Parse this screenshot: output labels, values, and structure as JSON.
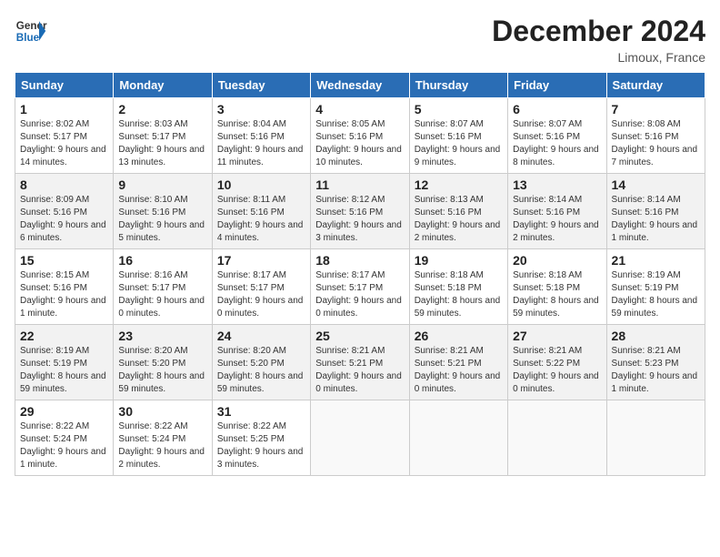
{
  "header": {
    "logo_general": "General",
    "logo_blue": "Blue",
    "month_title": "December 2024",
    "location": "Limoux, France"
  },
  "weekdays": [
    "Sunday",
    "Monday",
    "Tuesday",
    "Wednesday",
    "Thursday",
    "Friday",
    "Saturday"
  ],
  "weeks": [
    [
      {
        "day": "1",
        "sunrise": "8:02 AM",
        "sunset": "5:17 PM",
        "daylight": "9 hours and 14 minutes."
      },
      {
        "day": "2",
        "sunrise": "8:03 AM",
        "sunset": "5:17 PM",
        "daylight": "9 hours and 13 minutes."
      },
      {
        "day": "3",
        "sunrise": "8:04 AM",
        "sunset": "5:16 PM",
        "daylight": "9 hours and 11 minutes."
      },
      {
        "day": "4",
        "sunrise": "8:05 AM",
        "sunset": "5:16 PM",
        "daylight": "9 hours and 10 minutes."
      },
      {
        "day": "5",
        "sunrise": "8:07 AM",
        "sunset": "5:16 PM",
        "daylight": "9 hours and 9 minutes."
      },
      {
        "day": "6",
        "sunrise": "8:07 AM",
        "sunset": "5:16 PM",
        "daylight": "9 hours and 8 minutes."
      },
      {
        "day": "7",
        "sunrise": "8:08 AM",
        "sunset": "5:16 PM",
        "daylight": "9 hours and 7 minutes."
      }
    ],
    [
      {
        "day": "8",
        "sunrise": "8:09 AM",
        "sunset": "5:16 PM",
        "daylight": "9 hours and 6 minutes."
      },
      {
        "day": "9",
        "sunrise": "8:10 AM",
        "sunset": "5:16 PM",
        "daylight": "9 hours and 5 minutes."
      },
      {
        "day": "10",
        "sunrise": "8:11 AM",
        "sunset": "5:16 PM",
        "daylight": "9 hours and 4 minutes."
      },
      {
        "day": "11",
        "sunrise": "8:12 AM",
        "sunset": "5:16 PM",
        "daylight": "9 hours and 3 minutes."
      },
      {
        "day": "12",
        "sunrise": "8:13 AM",
        "sunset": "5:16 PM",
        "daylight": "9 hours and 2 minutes."
      },
      {
        "day": "13",
        "sunrise": "8:14 AM",
        "sunset": "5:16 PM",
        "daylight": "9 hours and 2 minutes."
      },
      {
        "day": "14",
        "sunrise": "8:14 AM",
        "sunset": "5:16 PM",
        "daylight": "9 hours and 1 minute."
      }
    ],
    [
      {
        "day": "15",
        "sunrise": "8:15 AM",
        "sunset": "5:16 PM",
        "daylight": "9 hours and 1 minute."
      },
      {
        "day": "16",
        "sunrise": "8:16 AM",
        "sunset": "5:17 PM",
        "daylight": "9 hours and 0 minutes."
      },
      {
        "day": "17",
        "sunrise": "8:17 AM",
        "sunset": "5:17 PM",
        "daylight": "9 hours and 0 minutes."
      },
      {
        "day": "18",
        "sunrise": "8:17 AM",
        "sunset": "5:17 PM",
        "daylight": "9 hours and 0 minutes."
      },
      {
        "day": "19",
        "sunrise": "8:18 AM",
        "sunset": "5:18 PM",
        "daylight": "8 hours and 59 minutes."
      },
      {
        "day": "20",
        "sunrise": "8:18 AM",
        "sunset": "5:18 PM",
        "daylight": "8 hours and 59 minutes."
      },
      {
        "day": "21",
        "sunrise": "8:19 AM",
        "sunset": "5:19 PM",
        "daylight": "8 hours and 59 minutes."
      }
    ],
    [
      {
        "day": "22",
        "sunrise": "8:19 AM",
        "sunset": "5:19 PM",
        "daylight": "8 hours and 59 minutes."
      },
      {
        "day": "23",
        "sunrise": "8:20 AM",
        "sunset": "5:20 PM",
        "daylight": "8 hours and 59 minutes."
      },
      {
        "day": "24",
        "sunrise": "8:20 AM",
        "sunset": "5:20 PM",
        "daylight": "8 hours and 59 minutes."
      },
      {
        "day": "25",
        "sunrise": "8:21 AM",
        "sunset": "5:21 PM",
        "daylight": "9 hours and 0 minutes."
      },
      {
        "day": "26",
        "sunrise": "8:21 AM",
        "sunset": "5:21 PM",
        "daylight": "9 hours and 0 minutes."
      },
      {
        "day": "27",
        "sunrise": "8:21 AM",
        "sunset": "5:22 PM",
        "daylight": "9 hours and 0 minutes."
      },
      {
        "day": "28",
        "sunrise": "8:21 AM",
        "sunset": "5:23 PM",
        "daylight": "9 hours and 1 minute."
      }
    ],
    [
      {
        "day": "29",
        "sunrise": "8:22 AM",
        "sunset": "5:24 PM",
        "daylight": "9 hours and 1 minute."
      },
      {
        "day": "30",
        "sunrise": "8:22 AM",
        "sunset": "5:24 PM",
        "daylight": "9 hours and 2 minutes."
      },
      {
        "day": "31",
        "sunrise": "8:22 AM",
        "sunset": "5:25 PM",
        "daylight": "9 hours and 3 minutes."
      },
      null,
      null,
      null,
      null
    ]
  ]
}
